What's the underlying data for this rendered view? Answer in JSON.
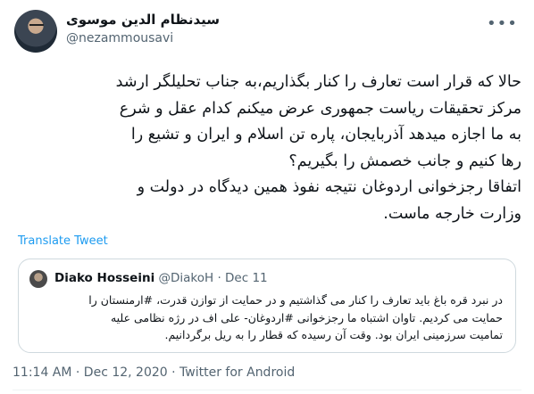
{
  "author": {
    "display_name": "سیدنظام الدین موسوی",
    "handle": "@nezammousavi"
  },
  "tweet": {
    "lines": [
      "حالا که قرار است تعارف را کنار بگذاریم،به جناب تحلیلگر ارشد",
      "مرکز تحقیقات ریاست جمهوری عرض میکنم کدام عقل و شرع",
      "به ما اجازه میدهد آذربایجان، پاره تن اسلام و ایران و تشیع را",
      "رها کنیم و جانب خصمش را بگیریم؟",
      "اتفاقا رجزخوانی اردوغان نتیجه نفوذ همین دیدگاه در دولت و",
      "وزارت خارجه ماست."
    ],
    "translate_label": "Translate Tweet"
  },
  "quoted": {
    "name": "Diako Hosseini",
    "meta": "@DiakoH · Dec 11",
    "lines": [
      "در نبرد قره باغ باید تعارف را کنار می گذاشتیم و در حمایت از توازن قدرت، #ارمنستان را",
      "حمایت می کردیم. تاوان اشتباه ما رجزخوانی #اردوغان- علی اف در رژه نظامی علیه",
      "تمامیت سرزمینی ایران بود. وقت آن رسیده که قطار را به ریل برگردانیم."
    ]
  },
  "footer": {
    "text": "11:14 AM · Dec 12, 2020 · Twitter for Android"
  },
  "icons": {
    "more": "more-horizontal-icon"
  },
  "colors": {
    "link": "#1d9bf0",
    "secondary": "#536471",
    "border": "#cfd9de"
  }
}
